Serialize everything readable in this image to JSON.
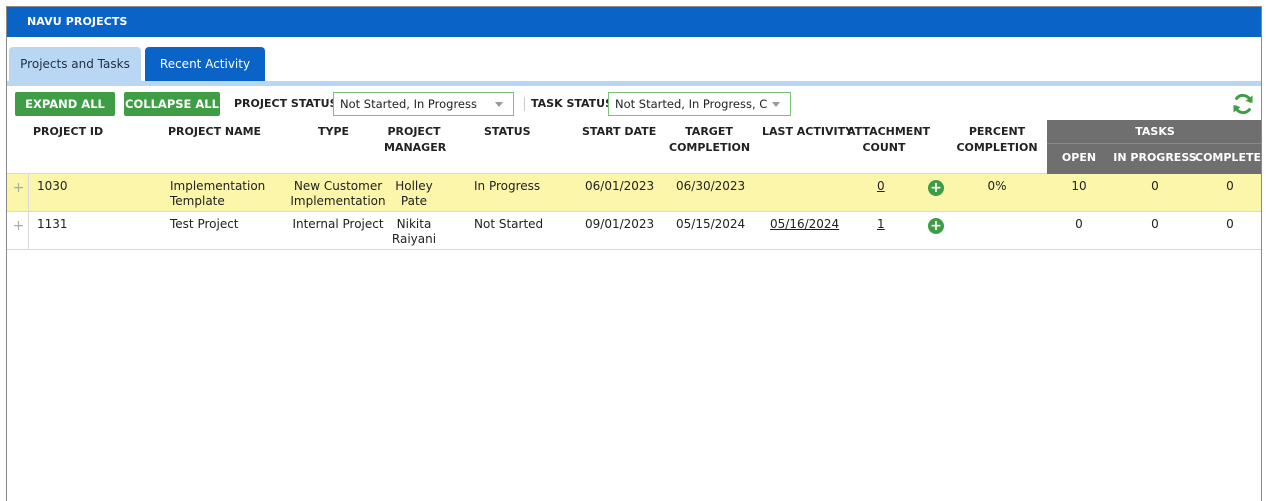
{
  "title": "NAVU PROJECTS",
  "tabs": [
    {
      "label": "Projects and Tasks",
      "active": true
    },
    {
      "label": "Recent Activity",
      "active": false
    }
  ],
  "toolbar": {
    "expand_label": "EXPAND ALL",
    "collapse_label": "COLLAPSE ALL",
    "project_status_label": "PROJECT STATUS",
    "project_status_value": "Not Started, In Progress",
    "task_status_label": "TASK STATUS",
    "task_status_value": "Not Started, In Progress, Cor",
    "refresh_icon": "refresh-icon"
  },
  "columns": {
    "project_id": "PROJECT ID",
    "project_name": "PROJECT NAME",
    "type": "TYPE",
    "project_manager_1": "PROJECT",
    "project_manager_2": "MANAGER",
    "status": "STATUS",
    "start_date": "START DATE",
    "target_completion_1": "TARGET",
    "target_completion_2": "COMPLETION",
    "last_activity": "LAST ACTIVITY",
    "attachment_count_1": "ATTACHMENT",
    "attachment_count_2": "COUNT",
    "percent_completion_1": "PERCENT",
    "percent_completion_2": "COMPLETION",
    "tasks": "TASKS",
    "tasks_open": "OPEN",
    "tasks_in_progress": "IN PROGRESS",
    "tasks_completed": "COMPLETED"
  },
  "rows": [
    {
      "project_id": "1030",
      "name_1": "Implementation",
      "name_2": "Template",
      "type_1": "New Customer",
      "type_2": "Implementation",
      "manager_1": "Holley",
      "manager_2": "Pate",
      "status": "In Progress",
      "start_date": "06/01/2023",
      "target_completion": "06/30/2023",
      "last_activity": "",
      "attachment_count": "0",
      "percent_completion": "0%",
      "tasks_open": "10",
      "tasks_in_progress": "0",
      "tasks_completed": "0",
      "highlighted": true
    },
    {
      "project_id": "1131",
      "name_1": "Test Project",
      "name_2": "",
      "type_1": "Internal Project",
      "type_2": "",
      "manager_1": "Nikita",
      "manager_2": "Raiyani",
      "status": "Not Started",
      "start_date": "09/01/2023",
      "target_completion": "05/15/2024",
      "last_activity": "05/16/2024",
      "attachment_count": "1",
      "percent_completion": "",
      "tasks_open": "0",
      "tasks_in_progress": "0",
      "tasks_completed": "0",
      "highlighted": false
    }
  ],
  "colors": {
    "brand_blue": "#0a64c8",
    "tab_light": "#b9d6f2",
    "button_green": "#3f9d45",
    "row_highlight": "#fbf6a9",
    "tasks_header": "#6f6f6f"
  }
}
